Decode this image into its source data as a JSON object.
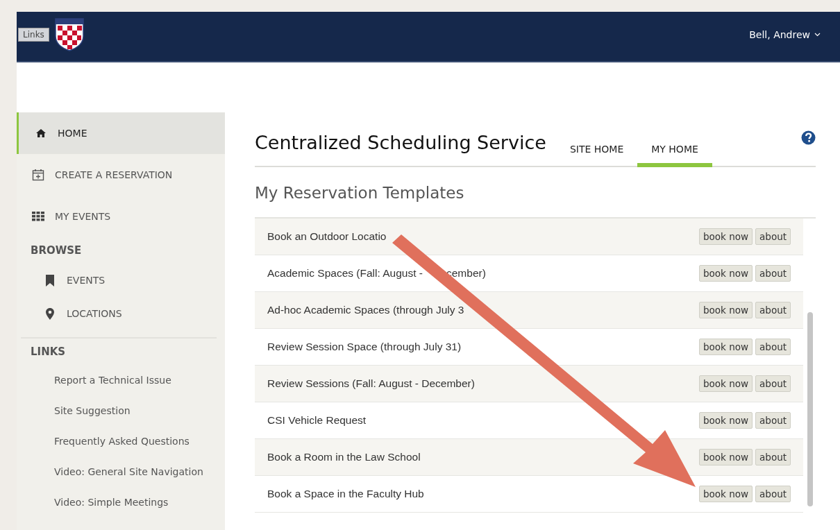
{
  "header": {
    "links_button": "Links",
    "user_menu": "Bell, Andrew"
  },
  "sidebar": {
    "items": [
      {
        "label": "HOME",
        "selected": true
      },
      {
        "label": "CREATE A RESERVATION",
        "selected": false
      },
      {
        "label": "MY EVENTS",
        "selected": false
      }
    ],
    "browse": {
      "heading": "BROWSE",
      "items": [
        {
          "label": "EVENTS",
          "selected": false
        },
        {
          "label": "LOCATIONS",
          "selected": false
        }
      ]
    },
    "links": {
      "heading": "LINKS",
      "items": [
        "Report a Technical Issue",
        "Site Suggestion",
        "Frequently Asked Questions",
        "Video: General Site Navigation",
        "Video: Simple Meetings"
      ]
    }
  },
  "main": {
    "title": "Centralized Scheduling Service",
    "tabs": [
      {
        "label": "SITE HOME",
        "selected": false
      },
      {
        "label": "MY HOME",
        "selected": true
      }
    ],
    "section_title": "My Reservation Templates",
    "templates": [
      {
        "name": "Book an Outdoor Locatio",
        "book": "book now",
        "about": "about"
      },
      {
        "name": "Academic Spaces (Fall: August -",
        "name_tail": "cember)",
        "book": "book now",
        "about": "about"
      },
      {
        "name": "Ad-hoc Academic Spaces (through July 3",
        "book": "book now",
        "about": "about"
      },
      {
        "name": "Review Session Space (through July 31)",
        "book": "book now",
        "about": "about"
      },
      {
        "name": "Review Sessions (Fall: August - December)",
        "book": "book now",
        "about": "about"
      },
      {
        "name": "CSI Vehicle Request",
        "book": "book now",
        "about": "about"
      },
      {
        "name": "Book a Room in the Law School",
        "book": "book now",
        "about": "about"
      },
      {
        "name": "Book a Space in the Faculty Hub",
        "book": "book now",
        "about": "about"
      }
    ]
  }
}
